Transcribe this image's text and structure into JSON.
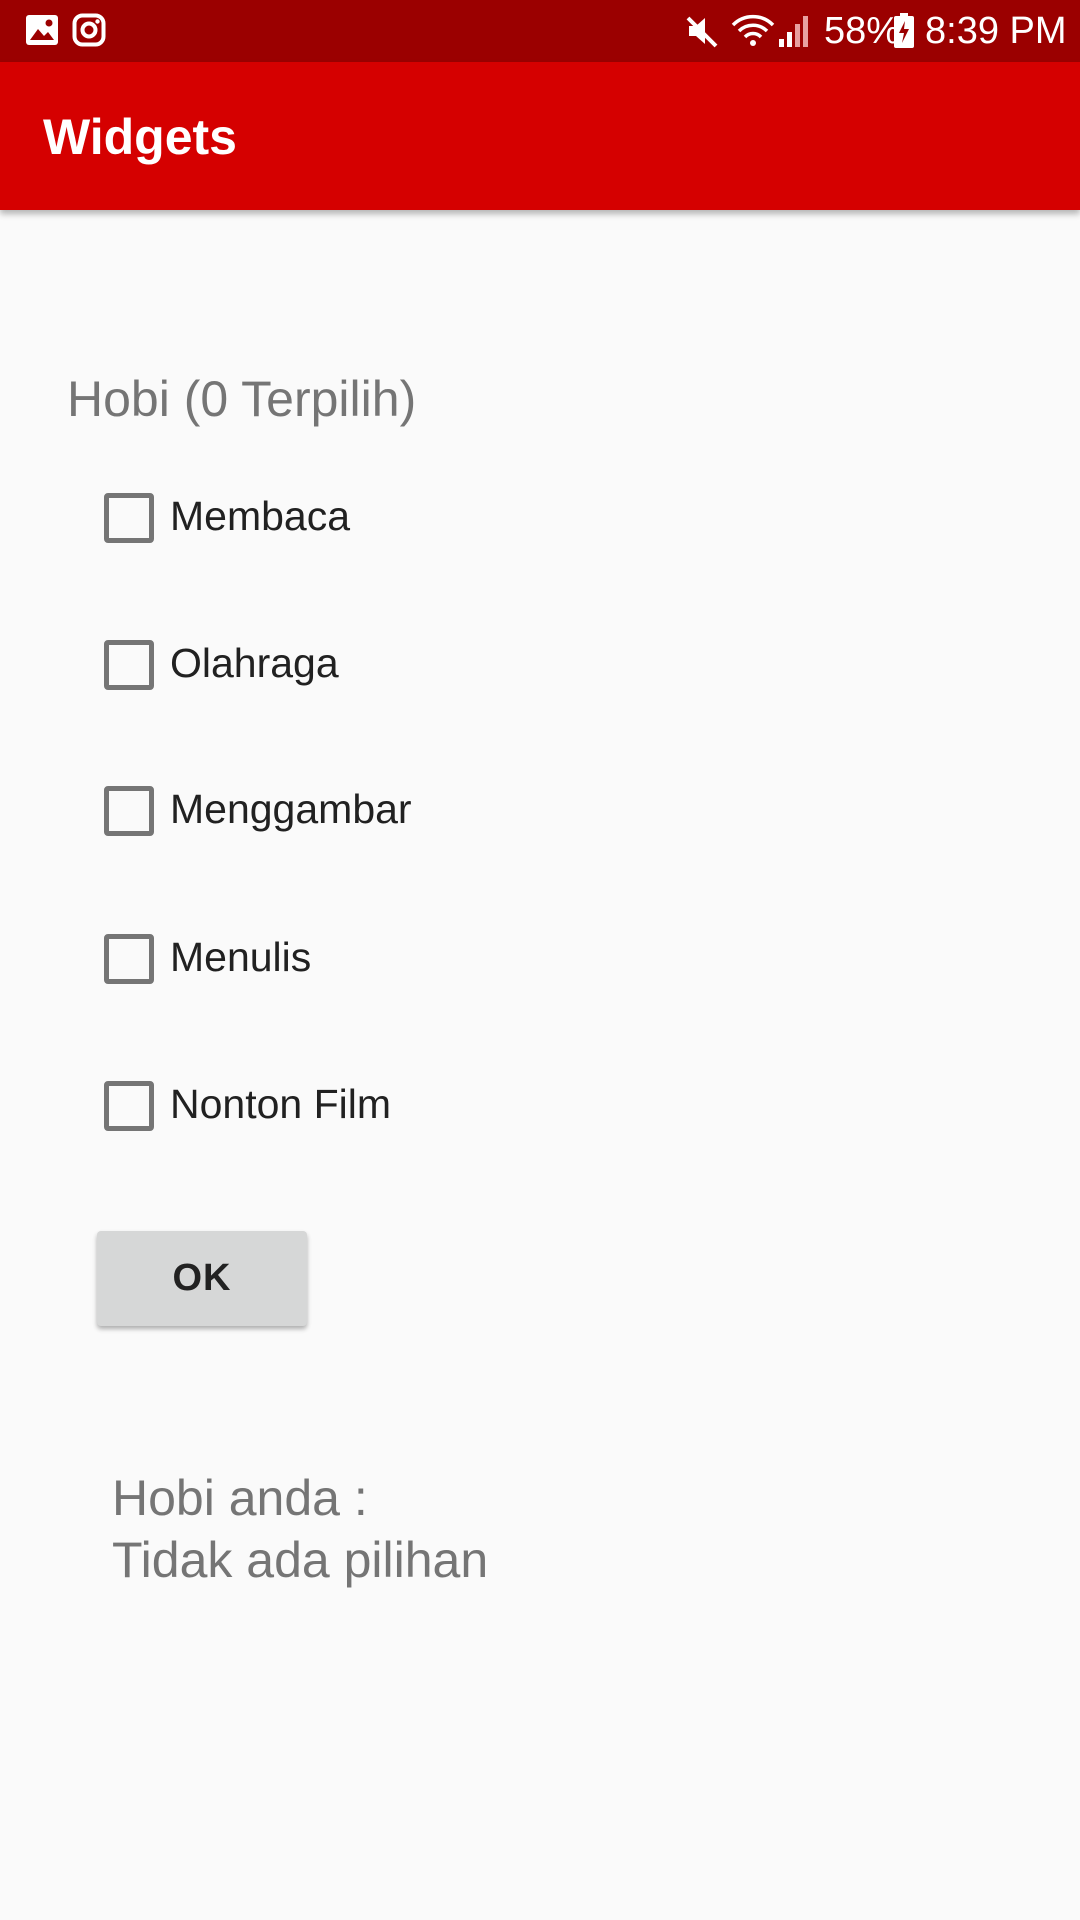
{
  "status_bar": {
    "battery": "58%",
    "time": "8:39 PM",
    "left_icons": [
      "gallery-icon",
      "instagram-icon"
    ],
    "right_icons": [
      "mute-icon",
      "wifi-icon",
      "signal-icon",
      "battery-charging-icon"
    ],
    "background": "#9b0000"
  },
  "app_bar": {
    "title": "Widgets",
    "background": "#d50000"
  },
  "hobbies": {
    "title": "Hobi (0 Terpilih)",
    "options": [
      {
        "label": "Membaca",
        "checked": false
      },
      {
        "label": "Olahraga",
        "checked": false
      },
      {
        "label": "Menggambar",
        "checked": false
      },
      {
        "label": "Menulis",
        "checked": false
      },
      {
        "label": "Nonton Film",
        "checked": false
      }
    ]
  },
  "ok_button": {
    "label": "OK"
  },
  "result": {
    "heading": "Hobi anda :",
    "value": "Tidak ada pilihan"
  }
}
